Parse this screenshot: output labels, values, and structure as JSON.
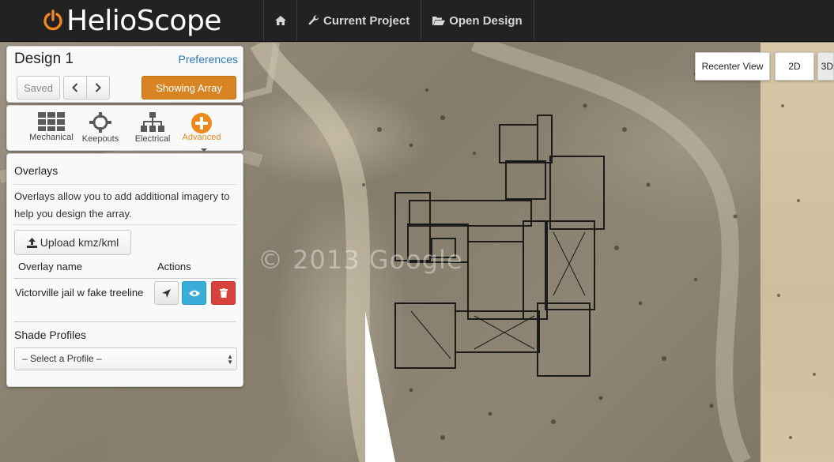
{
  "brand": {
    "name": "HelioScope",
    "accent": "#f0891d"
  },
  "nav": {
    "home_icon": "home-icon",
    "current_project": "Current Project",
    "open_design": "Open Design"
  },
  "map": {
    "watermark": "© 2013 Google",
    "recenter": "Recenter View",
    "view_2d": "2D",
    "view_3d": "3D"
  },
  "design_panel": {
    "title": "Design 1",
    "preferences": "Preferences",
    "saved": "Saved",
    "showing": "Showing Array"
  },
  "tools": [
    {
      "label": "Mechanical",
      "icon": "grid-icon"
    },
    {
      "label": "Keepouts",
      "icon": "keepout-crosshair-icon"
    },
    {
      "label": "Electrical",
      "icon": "sitemap-icon"
    },
    {
      "label": "Advanced",
      "icon": "plus-circle-icon",
      "active": true
    }
  ],
  "overlays": {
    "title": "Overlays",
    "description": "Overlays allow you to add additional imagery to help you design the array.",
    "upload": "Upload kmz/kml",
    "col_name": "Overlay name",
    "col_actions": "Actions",
    "rows": [
      {
        "name": "Victorville jail w fake treeline"
      }
    ]
  },
  "shade": {
    "title": "Shade Profiles",
    "select_value": "– Select a Profile –"
  }
}
